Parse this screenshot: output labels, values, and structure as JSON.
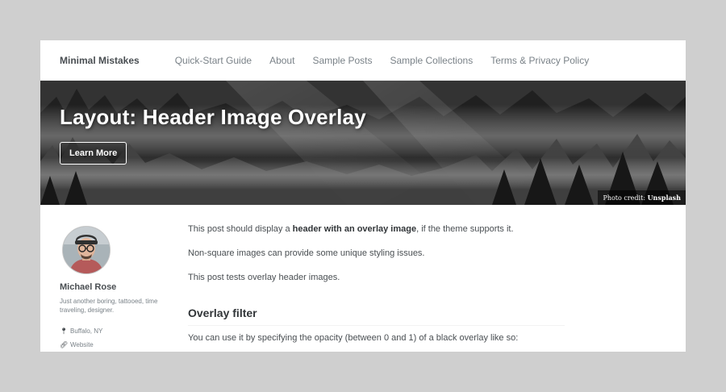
{
  "masthead": {
    "site_title": "Minimal Mistakes",
    "nav": [
      "Quick-Start Guide",
      "About",
      "Sample Posts",
      "Sample Collections",
      "Terms & Privacy Policy"
    ]
  },
  "hero": {
    "title": "Layout: Header Image Overlay",
    "cta_label": "Learn More",
    "credit_prefix": "Photo credit:",
    "credit_source": "Unsplash"
  },
  "author": {
    "name": "Michael Rose",
    "bio": "Just another boring, tattooed, time traveling, designer.",
    "location": "Buffalo, NY",
    "website_label": "Website"
  },
  "post": {
    "p1_before": "This post should display a ",
    "p1_bold": "header with an overlay image",
    "p1_after": ", if the theme supports it.",
    "p2": "Non-square images can provide some unique styling issues.",
    "p3": "This post tests overlay header images.",
    "h2": "Overlay filter",
    "p4": "You can use it by specifying the opacity (between 0 and 1) of a black overlay like so:"
  },
  "icons": {
    "location": "map-marker-icon",
    "website": "link-icon"
  },
  "colors": {
    "background": "#cfcfcf",
    "text": "#494e52",
    "muted": "#7a8288"
  }
}
